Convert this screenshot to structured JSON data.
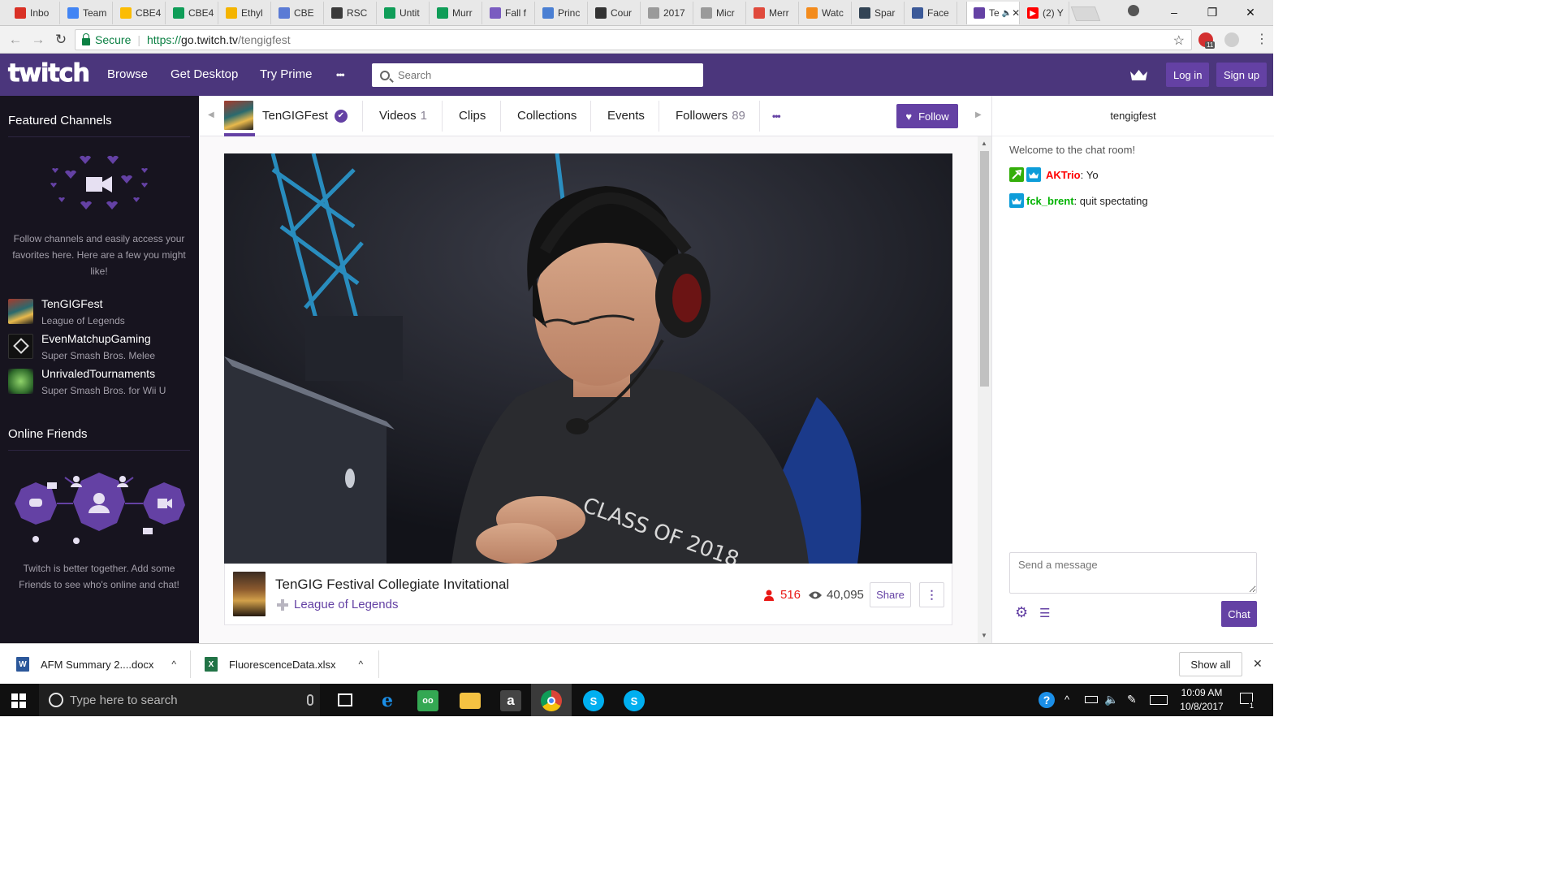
{
  "browser": {
    "tabs": [
      {
        "label": "Inbo",
        "icon": "gmail-icon",
        "color": "#d93025"
      },
      {
        "label": "Team",
        "icon": "docs-icon",
        "color": "#4285f4"
      },
      {
        "label": "CBE4",
        "icon": "drive-icon",
        "color": "#fbbc04"
      },
      {
        "label": "CBE4",
        "icon": "sheets-icon",
        "color": "#0f9d58"
      },
      {
        "label": "Ethyl",
        "icon": "slides-icon",
        "color": "#f4b400"
      },
      {
        "label": "CBE",
        "icon": "pearson-icon",
        "color": "#5b7bd5"
      },
      {
        "label": "RSC",
        "icon": "rsc-icon",
        "color": "#3b3b3b"
      },
      {
        "label": "Untit",
        "icon": "sheets-icon",
        "color": "#0f9d58"
      },
      {
        "label": "Murr",
        "icon": "sheets-icon",
        "color": "#0f9d58"
      },
      {
        "label": "Fall f",
        "icon": "forms-icon",
        "color": "#7a5cc0"
      },
      {
        "label": "Princ",
        "icon": "calendar-icon",
        "color": "#4a7fd3"
      },
      {
        "label": "Cour",
        "icon": "blackboard-icon",
        "color": "#333333"
      },
      {
        "label": "2017",
        "icon": "file-icon",
        "color": "#9a9a9a"
      },
      {
        "label": "Micr",
        "icon": "file-icon",
        "color": "#9a9a9a"
      },
      {
        "label": "Merr",
        "icon": "os-icon",
        "color": "#e04a3c"
      },
      {
        "label": "Watc",
        "icon": "s-icon",
        "color": "#f38b1c"
      },
      {
        "label": "Spar",
        "icon": "spark-icon",
        "color": "#334455"
      },
      {
        "label": "Face",
        "icon": "facebook-icon",
        "color": "#3b5998"
      }
    ],
    "active_tab": {
      "label": "Te",
      "speaker": "🔈",
      "close": "✕"
    },
    "youtube_tab": {
      "label": "(2) Y",
      "color": "#ff0000"
    },
    "window_min": "–",
    "window_max": "❐",
    "window_close": "✕",
    "nav_back": "←",
    "nav_forward": "→",
    "nav_reload": "↻",
    "secure_label": "Secure",
    "url_scheme": "https://",
    "url_host": "go.twitch.tv",
    "url_path": "/tengigfest",
    "star": "☆",
    "ext_badge": "11"
  },
  "twitch_nav": {
    "logo": "twitch",
    "links": [
      "Browse",
      "Get Desktop",
      "Try Prime"
    ],
    "more": "•••",
    "search_placeholder": "Search",
    "login": "Log in",
    "signup": "Sign up",
    "accent": "#6441a4",
    "bar_color": "#4b367c"
  },
  "sidebar": {
    "featured_title": "Featured Channels",
    "featured_text": "Follow channels and easily access your favorites here. Here are a few you might like!",
    "channels": [
      {
        "name": "TenGIGFest",
        "game": "League of Legends"
      },
      {
        "name": "EvenMatchupGaming",
        "game": "Super Smash Bros. Melee"
      },
      {
        "name": "UnrivaledTournaments",
        "game": "Super Smash Bros. for Wii U"
      }
    ],
    "friends_title": "Online Friends",
    "friends_text": "Twitch is better together. Add some Friends to see who's online and chat!"
  },
  "channel": {
    "name": "TenGIGFest",
    "verified": "✔",
    "tabs": [
      {
        "label": "Videos",
        "count": "1"
      },
      {
        "label": "Clips",
        "count": ""
      },
      {
        "label": "Collections",
        "count": ""
      },
      {
        "label": "Events",
        "count": ""
      },
      {
        "label": "Followers",
        "count": "89"
      }
    ],
    "more": "•••",
    "follow": "Follow",
    "follow_heart": "♥",
    "arrow_left": "◀",
    "arrow_right": "▶"
  },
  "stream": {
    "title": "TenGIG Festival Collegiate Invitational",
    "game": "League of Legends",
    "viewers": "516",
    "views": "40,095",
    "share": "Share",
    "more": "⋮",
    "viewer_color": "#e91916"
  },
  "chat": {
    "header": "tengigfest",
    "welcome": "Welcome to the chat room!",
    "messages": [
      {
        "user": "AKTrio",
        "text": "Yo",
        "color": "#ff0000"
      },
      {
        "user": "fck_brent",
        "text": "quit spectating",
        "color": "#00b200"
      }
    ],
    "input_placeholder": "Send a message",
    "send": "Chat",
    "settings": "⚙",
    "list": "☰"
  },
  "downloads": {
    "items": [
      {
        "name": "AFM Summary 2....docx",
        "icon": "word-doc-icon",
        "letter": "W",
        "color": "#2b579a"
      },
      {
        "name": "FluorescenceData.xlsx",
        "icon": "excel-doc-icon",
        "letter": "X",
        "color": "#217346"
      }
    ],
    "caret": "^",
    "show_all": "Show all",
    "close": "✕"
  },
  "taskbar": {
    "search_placeholder": "Type here to search",
    "mic": "🎤",
    "time": "10:09 AM",
    "date": "10/8/2017",
    "tray": "^",
    "notif_count": "1",
    "help": "?",
    "apps": [
      {
        "name": "edge-icon",
        "letter": "e",
        "color": "#0078d7"
      },
      {
        "name": "tripadvisor-icon",
        "letter": "oo",
        "color": "#34a853"
      },
      {
        "name": "file-explorer-icon",
        "letter": "",
        "color": "#f5c242"
      },
      {
        "name": "amazon-icon",
        "letter": "a",
        "color": "#333333"
      },
      {
        "name": "chrome-icon",
        "letter": "",
        "color": "#db4437"
      },
      {
        "name": "skype-icon",
        "letter": "S",
        "color": "#00aff0"
      },
      {
        "name": "skype-icon-2",
        "letter": "S",
        "color": "#00aff0"
      }
    ]
  }
}
